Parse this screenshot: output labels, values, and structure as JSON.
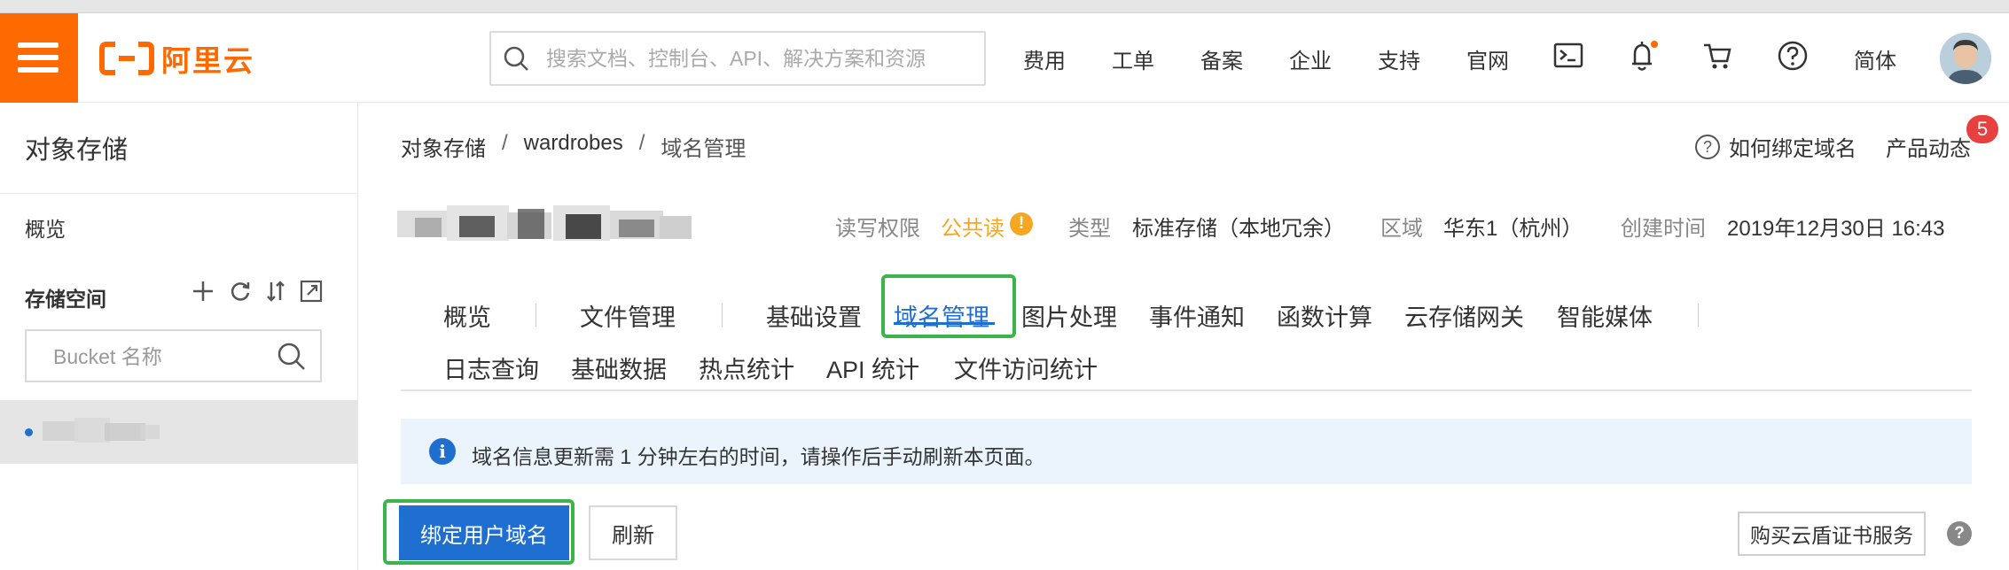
{
  "header": {
    "logo_text": "阿里云",
    "search_placeholder": "搜索文档、控制台、API、解决方案和资源",
    "nav": [
      "费用",
      "工单",
      "备案",
      "企业",
      "支持",
      "官网"
    ],
    "language": "简体"
  },
  "sidebar": {
    "title": "对象存储",
    "overview": "概览",
    "buckets_label": "存储空间",
    "bucket_search_placeholder": "Bucket 名称"
  },
  "breadcrumb": {
    "root": "对象存储",
    "sep": "/",
    "bucket": "wardrobes",
    "current": "域名管理"
  },
  "help": {
    "bind_domain_help": "如何绑定域名",
    "product_news": "产品动态",
    "news_count": "5"
  },
  "bucket_meta": {
    "acl_label": "读写权限",
    "acl_value": "公共读",
    "type_label": "类型",
    "type_value": "标准存储（本地冗余）",
    "region_label": "区域",
    "region_value": "华东1（杭州）",
    "created_label": "创建时间",
    "created_value": "2019年12月30日 16:43"
  },
  "tabs": {
    "row1": [
      "概览",
      "文件管理",
      "基础设置",
      "域名管理",
      "图片处理",
      "事件通知",
      "函数计算",
      "云存储网关",
      "智能媒体"
    ],
    "row2": [
      "日志查询",
      "基础数据",
      "热点统计",
      "API 统计",
      "文件访问统计"
    ],
    "active": "域名管理"
  },
  "notice": {
    "text": "域名信息更新需 1 分钟左右的时间，请操作后手动刷新本页面。"
  },
  "actions": {
    "bind_domain": "绑定用户域名",
    "refresh": "刷新",
    "buy_cert": "购买云盾证书服务"
  },
  "colors": {
    "brand": "#ff6a00",
    "primary": "#1f6fd1",
    "warning": "#f5a623",
    "highlight": "#3bb54a",
    "badge": "#e8403e"
  }
}
